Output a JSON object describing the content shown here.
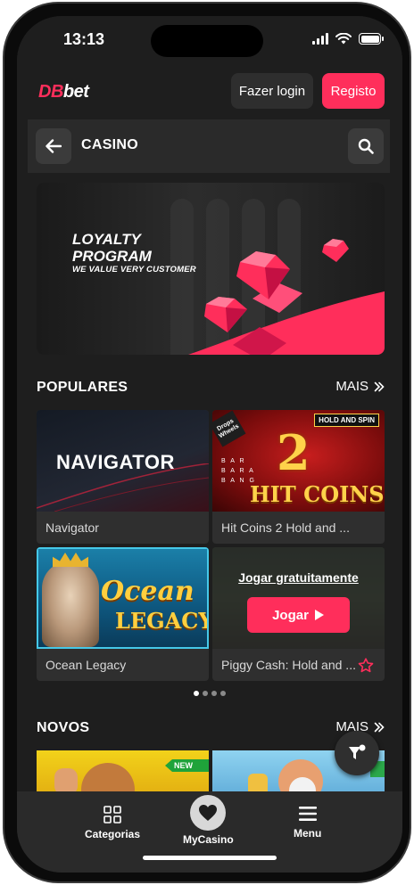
{
  "status_bar": {
    "time": "13:13"
  },
  "header": {
    "logo_db": "DB",
    "logo_bet": "bet",
    "login_label": "Fazer login",
    "register_label": "Registo"
  },
  "casino_bar": {
    "title": "CASINO"
  },
  "banner": {
    "title_line1": "LOYALTY",
    "title_line2": "PROGRAM",
    "subtitle": "WE VALUE VERY CUSTOMER"
  },
  "populares": {
    "title": "POPULARES",
    "more_label": "MAIS",
    "games": [
      {
        "name": "Navigator",
        "thumb_text": "NAVIGATOR"
      },
      {
        "name": "Hit Coins 2 Hold and ...",
        "thumb_big": "2",
        "thumb_text": "HIT COINS",
        "badge": "HOLD AND SPIN",
        "corner": "Drops Wheels",
        "side_text": "B A R\nB A R A\nB A N G"
      },
      {
        "name": "Ocean Legacy",
        "thumb_line1": "Ocean",
        "thumb_line2": "LEGACY"
      },
      {
        "name": "Piggy Cash: Hold and ...",
        "play_free": "Jogar gratuitamente",
        "play_label": "Jogar"
      }
    ],
    "pager": {
      "pages": 4,
      "active": 0
    }
  },
  "novos": {
    "title": "NOVOS",
    "more_label": "MAIS",
    "new_tag": "NEW"
  },
  "bottom_nav": {
    "categories_label": "Categorias",
    "mycasino_label": "MyCasino",
    "menu_label": "Menu"
  },
  "colors": {
    "accent": "#ff2e5b",
    "background": "#1e1e1e",
    "card": "#2f2f2f"
  }
}
